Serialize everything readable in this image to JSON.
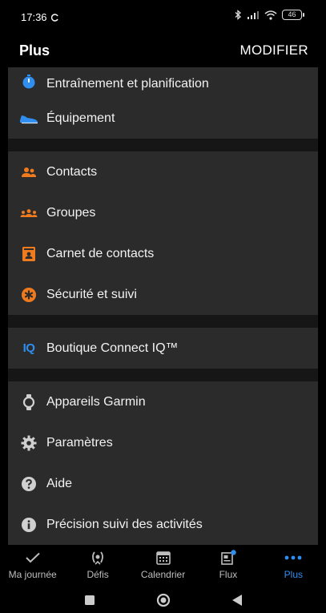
{
  "status": {
    "time": "17:36",
    "battery": "46"
  },
  "header": {
    "title": "Plus",
    "action": "MODIFIER"
  },
  "menu": {
    "training": "Entraînement et planification",
    "equipment": "Équipement",
    "contacts": "Contacts",
    "groups": "Groupes",
    "address_book": "Carnet de contacts",
    "safety": "Sécurité et suivi",
    "connect_iq_badge": "IQ",
    "connect_iq": "Boutique Connect IQ™",
    "devices": "Appareils Garmin",
    "settings": "Paramètres",
    "help": "Aide",
    "accuracy": "Précision suivi des activités"
  },
  "tabs": {
    "my_day": "Ma journée",
    "challenges": "Défis",
    "calendar": "Calendrier",
    "feed": "Flux",
    "more": "Plus"
  },
  "colors": {
    "accent_blue": "#2f8ef0",
    "accent_orange": "#f07b1e",
    "row_bg": "#2b2b2b",
    "separator": "#161616"
  }
}
